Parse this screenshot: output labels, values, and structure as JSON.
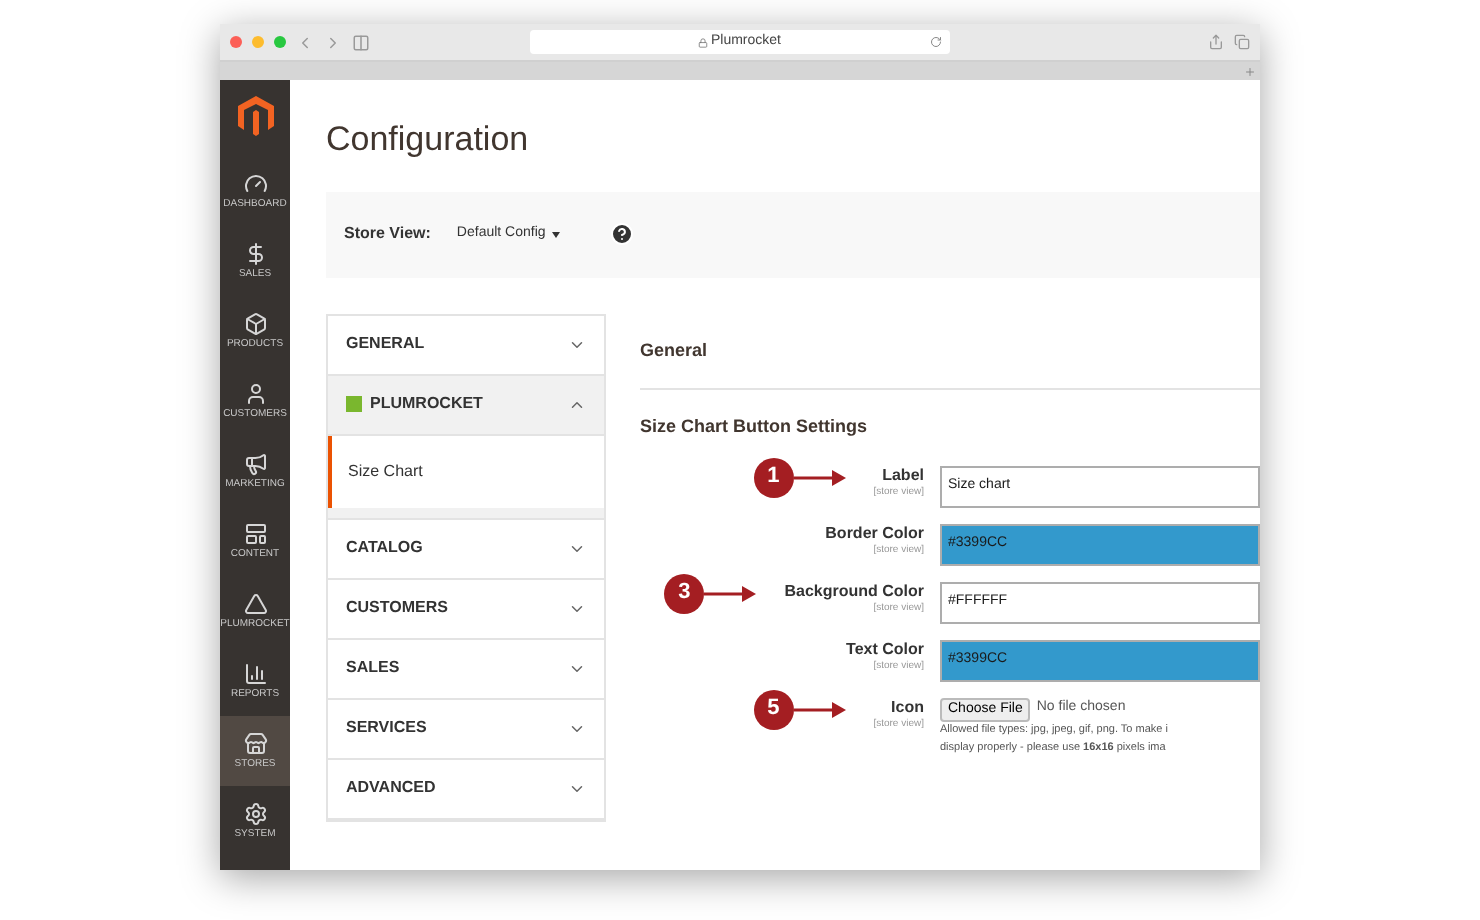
{
  "browser": {
    "address": "Plumrocket"
  },
  "sidebar": {
    "items": [
      {
        "label": "DASHBOARD",
        "selected": false
      },
      {
        "label": "SALES",
        "selected": false
      },
      {
        "label": "PRODUCTS",
        "selected": false
      },
      {
        "label": "CUSTOMERS",
        "selected": false
      },
      {
        "label": "MARKETING",
        "selected": false
      },
      {
        "label": "CONTENT",
        "selected": false
      },
      {
        "label": "PLUMROCKET",
        "selected": false
      },
      {
        "label": "REPORTS",
        "selected": false
      },
      {
        "label": "STORES",
        "selected": true
      },
      {
        "label": "SYSTEM",
        "selected": false
      }
    ]
  },
  "page_title": "Configuration",
  "store_view": {
    "label": "Store View:",
    "value": "Default Config"
  },
  "sections": [
    {
      "label": "GENERAL",
      "expanded": false,
      "logo": false
    },
    {
      "label": "PLUMROCKET",
      "expanded": true,
      "logo": true,
      "children": [
        {
          "label": "Size Chart",
          "selected": true
        }
      ]
    },
    {
      "label": "CATALOG",
      "expanded": false,
      "logo": false
    },
    {
      "label": "CUSTOMERS",
      "expanded": false,
      "logo": false
    },
    {
      "label": "SALES",
      "expanded": false,
      "logo": false
    },
    {
      "label": "SERVICES",
      "expanded": false,
      "logo": false
    },
    {
      "label": "ADVANCED",
      "expanded": false,
      "logo": false
    }
  ],
  "group_title": "General",
  "fieldset_title": "Size Chart Button Settings",
  "fields": [
    {
      "kind": "text",
      "label": "Label",
      "scope": "[store view]",
      "value": "Size chart",
      "callout": "1"
    },
    {
      "kind": "text",
      "label": "Border Color",
      "scope": "[store view]",
      "value": "#3399CC",
      "color": "#3399cc"
    },
    {
      "kind": "text",
      "label": "Background Color",
      "scope": "[store view]",
      "value": "#FFFFFF",
      "callout": "3"
    },
    {
      "kind": "text",
      "label": "Text Color",
      "scope": "[store view]",
      "value": "#3399CC",
      "color": "#3399cc"
    },
    {
      "kind": "file",
      "label": "Icon",
      "scope": "[store view]",
      "button": "Choose File",
      "value": "No file chosen",
      "callout": "5",
      "note": [
        "Allowed file types: jpg, jpeg, gif, png. To make i",
        "display properly - please use **16x16** pixels ima"
      ]
    }
  ]
}
